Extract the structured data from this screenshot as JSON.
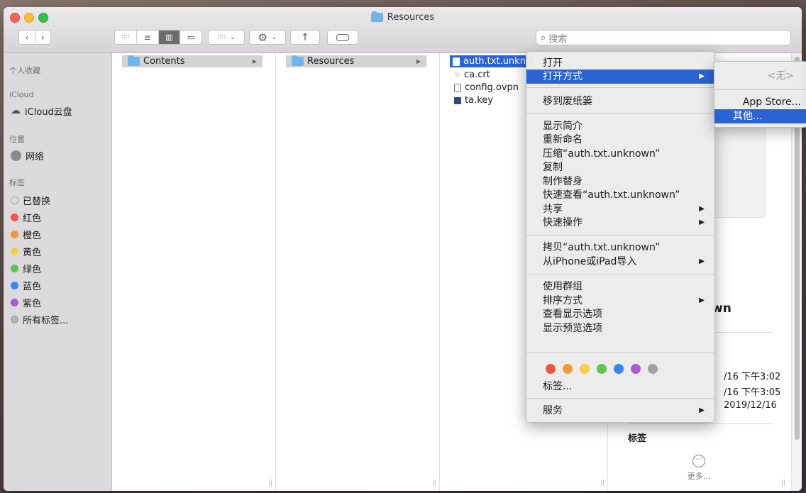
{
  "window": {
    "title": "Resources"
  },
  "toolbar": {
    "search_placeholder": "搜索",
    "back_icon": "chevron-left-icon",
    "forward_icon": "chevron-right-icon"
  },
  "sidebar": {
    "favorites_header": "个人收藏",
    "icloud_header": "iCloud",
    "icloud_drive": "iCloud云盘",
    "locations_header": "位置",
    "network": "网络",
    "tags_header": "标签",
    "tags": [
      {
        "label": "已替换",
        "color": "#a8a8a8"
      },
      {
        "label": "红色",
        "color": "#ee5449"
      },
      {
        "label": "橙色",
        "color": "#f19a36"
      },
      {
        "label": "黄色",
        "color": "#f5cf45"
      },
      {
        "label": "绿色",
        "color": "#5ec54e"
      },
      {
        "label": "蓝色",
        "color": "#3a86f0"
      },
      {
        "label": "紫色",
        "color": "#ad5ad5"
      },
      {
        "label": "所有标签...",
        "color": "#b5b5b5"
      }
    ]
  },
  "columns": {
    "col1": [
      {
        "label": "Contents"
      }
    ],
    "col2": [
      {
        "label": "Resources"
      }
    ],
    "col3": [
      {
        "label": "auth.txt.unkn"
      },
      {
        "label": "ca.crt"
      },
      {
        "label": "config.ovpn"
      },
      {
        "label": "ta.key"
      }
    ]
  },
  "preview": {
    "name_fragment": "wn",
    "created": "/16 下午3:02",
    "modified": "/16 下午3:05",
    "opened": "2019/12/16",
    "tags_label": "标签",
    "more": "更多..."
  },
  "context_menu": {
    "open": "打开",
    "open_with": "打开方式",
    "move_to_trash": "移到废纸篓",
    "get_info": "显示简介",
    "rename": "重新命名",
    "compress": "压缩“auth.txt.unknown”",
    "duplicate": "复制",
    "make_alias": "制作替身",
    "quick_look": "快速查看“auth.txt.unknown”",
    "share": "共享",
    "quick_actions": "快速操作",
    "copy": "拷贝“auth.txt.unknown”",
    "import_iphone": "从iPhone或iPad导入",
    "use_groups": "使用群组",
    "sort_by": "排序方式",
    "view_options": "查看显示选项",
    "preview_options": "显示预览选项",
    "tags": "标签...",
    "services": "服务",
    "tag_colors": [
      "#ee5449",
      "#f19a36",
      "#f5cf45",
      "#5ec54e",
      "#3a86f0",
      "#ad5ad5",
      "#a0a0a0"
    ]
  },
  "submenu": {
    "none": "<无>",
    "app_store": "App Store...",
    "other": "其他..."
  }
}
